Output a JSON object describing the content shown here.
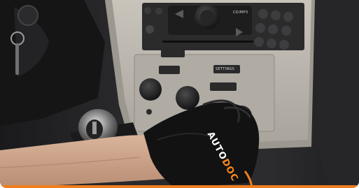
{
  "photo": {
    "colors": {
      "accent": "#f07e1c",
      "dashboard": "#b8b2aa",
      "console_dark": "#1c1c1e",
      "glove": "#141414"
    },
    "radio_buttons": {
      "cd_mp3": "CD/MP3",
      "setting": "SETTINGS"
    },
    "glove_brand": {
      "main": "AUTO",
      "tail": "DOC"
    }
  }
}
